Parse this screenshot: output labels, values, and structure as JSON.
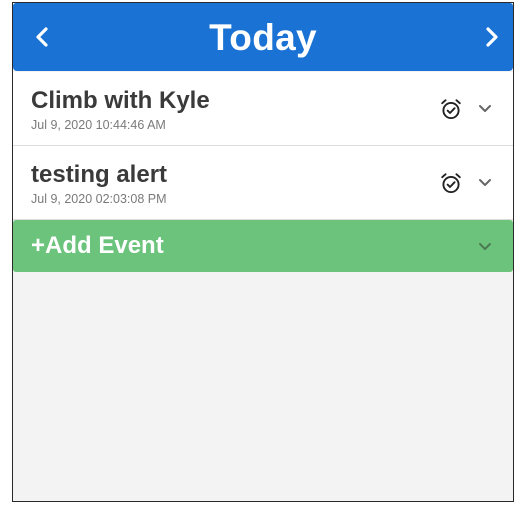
{
  "header": {
    "title": "Today",
    "prev_icon": "chevron-left-icon",
    "next_icon": "chevron-right-icon",
    "background_color": "#1a73d4"
  },
  "events": [
    {
      "title": "Climb with Kyle",
      "timestamp": "Jul 9, 2020 10:44:46 AM",
      "alarm_icon": "alarm-check-icon",
      "expand_icon": "chevron-down-icon"
    },
    {
      "title": "testing alert",
      "timestamp": "Jul 9, 2020 02:03:08 PM",
      "alarm_icon": "alarm-check-icon",
      "expand_icon": "chevron-down-icon"
    }
  ],
  "add_event": {
    "label": "+Add Event",
    "expand_icon": "chevron-down-icon",
    "background_color": "#6cc47c"
  }
}
